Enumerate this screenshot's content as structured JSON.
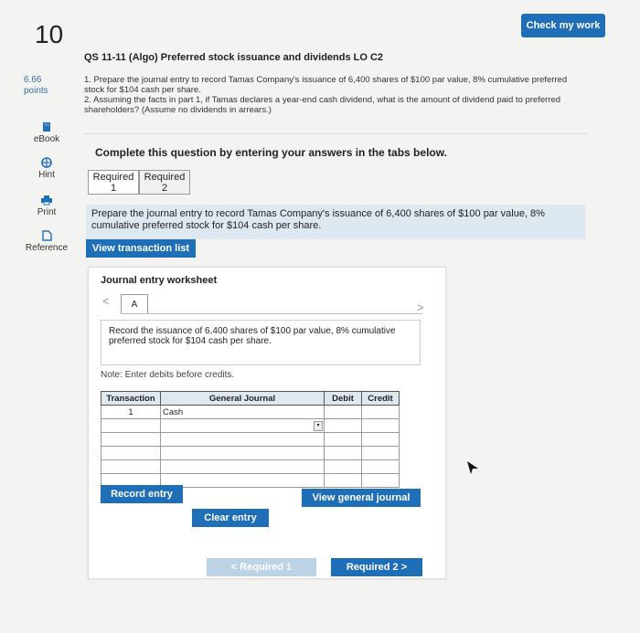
{
  "question": {
    "number": "10",
    "check_button": "Check my work",
    "title": "QS 11-11 (Algo) Preferred stock issuance and dividends LO C2",
    "points_value": "6.66",
    "points_label": "points",
    "text_line1": "1. Prepare the journal entry to record Tamas Company's issuance of 6,400 shares of $100 par value, 8% cumulative preferred stock for $104 cash per share.",
    "text_line2": "2. Assuming the facts in part 1, if Tamas declares a year-end cash dividend, what is the amount of dividend paid to preferred shareholders? (Assume no dividends in arrears.)"
  },
  "sidebar": {
    "items": [
      {
        "label": "eBook",
        "icon": "book-icon"
      },
      {
        "label": "Hint",
        "icon": "hint-icon"
      },
      {
        "label": "Print",
        "icon": "print-icon"
      },
      {
        "label": "Reference",
        "icon": "reference-icon"
      }
    ]
  },
  "main": {
    "complete_text": "Complete this question by entering your answers in the tabs below.",
    "tabs": [
      {
        "line1": "Required",
        "line2": "1"
      },
      {
        "line1": "Required",
        "line2": "2"
      }
    ],
    "instruction": "Prepare the journal entry to record Tamas Company's issuance of 6,400 shares of $100 par value, 8% cumulative preferred stock for $104 cash per share.",
    "view_transaction_list": "View transaction list"
  },
  "worksheet": {
    "title": "Journal entry worksheet",
    "nav_prev": "<",
    "nav_next": ">",
    "tab_label": "A",
    "record_text": "Record the issuance of 6,400 shares of $100 par value, 8% cumulative preferred stock for $104 cash per share.",
    "note": "Note: Enter debits before credits.",
    "columns": [
      "Transaction",
      "General Journal",
      "Debit",
      "Credit"
    ],
    "rows": [
      {
        "transaction": "1",
        "account": "Cash",
        "debit": "",
        "credit": ""
      },
      {
        "transaction": "",
        "account": "",
        "debit": "",
        "credit": ""
      },
      {
        "transaction": "",
        "account": "",
        "debit": "",
        "credit": ""
      },
      {
        "transaction": "",
        "account": "",
        "debit": "",
        "credit": ""
      },
      {
        "transaction": "",
        "account": "",
        "debit": "",
        "credit": ""
      },
      {
        "transaction": "",
        "account": "",
        "debit": "",
        "credit": ""
      }
    ],
    "record_entry": "Record entry",
    "clear_entry": "Clear entry",
    "view_general_journal": "View general journal"
  },
  "footer_nav": {
    "prev_label": "< Required 1",
    "next_label": "Required 2 >"
  },
  "colors": {
    "accent": "#1f6fb8",
    "panel": "#dde8f0",
    "disabled": "#bcd3e6"
  }
}
